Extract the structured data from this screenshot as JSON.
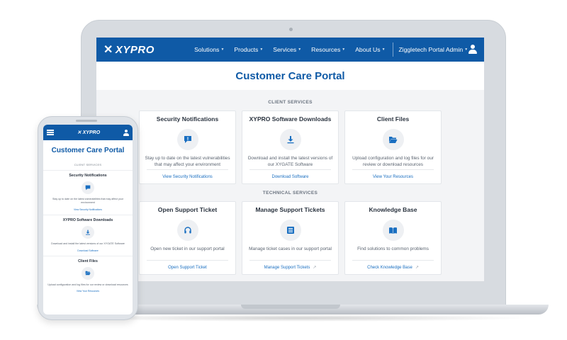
{
  "brand": {
    "name": "XYPRO",
    "accent": "#0f5aa6",
    "link_color": "#1a6fc1"
  },
  "nav": {
    "items": [
      {
        "label": "Solutions"
      },
      {
        "label": "Products"
      },
      {
        "label": "Services"
      },
      {
        "label": "Resources"
      },
      {
        "label": "About Us"
      }
    ],
    "admin_label": "Ziggletech Portal Admin",
    "user_icon": "user-icon"
  },
  "page": {
    "title": "Customer Care Portal"
  },
  "sections": [
    {
      "label": "CLIENT SERVICES",
      "cards": [
        {
          "title": "Security Notifications",
          "icon": "alert-message-icon",
          "description": "Stay up to date on the latest vulnerabilities that may affect your environment",
          "link": "View Security Notifications",
          "external": false
        },
        {
          "title": "XYPRO Software Downloads",
          "icon": "download-icon",
          "description": "Download and install the latest versions of our XYGATE Software",
          "link": "Download Software",
          "external": false
        },
        {
          "title": "Client Files",
          "icon": "folder-open-icon",
          "description": "Upload configuration and log files for our review or download resources",
          "link": "View Your Resources",
          "external": false
        }
      ]
    },
    {
      "label": "TECHNICAL SERVICES",
      "cards": [
        {
          "title": "Open Support Ticket",
          "icon": "headset-icon",
          "description": "Open new ticket in our support portal",
          "link": "Open Support Ticket",
          "external": false
        },
        {
          "title": "Manage Support Tickets",
          "icon": "list-alt-icon",
          "description": "Manage ticket cases in our support portal",
          "link": "Manage Support Tickets",
          "external": true
        },
        {
          "title": "Knowledge Base",
          "icon": "book-open-icon",
          "description": "Find solutions to common problems",
          "link": "Check Knowledge Base",
          "external": true
        }
      ]
    }
  ],
  "mobile": {
    "title": "Customer Care Portal",
    "section_label": "CLIENT SERVICES",
    "cards": [
      {
        "title": "Security Notifications",
        "description": "Stay up to date on the latest vulnerabilities that may affect your environment",
        "link": "View Security Notifications"
      },
      {
        "title": "XYPRO Software Downloads",
        "description": "Download and install the latest versions of our XYGATE Software",
        "link": "Download Software"
      },
      {
        "title": "Client Files",
        "description": "Upload configuration and log files for our review or download resources",
        "link": "View Your Resources"
      }
    ]
  }
}
